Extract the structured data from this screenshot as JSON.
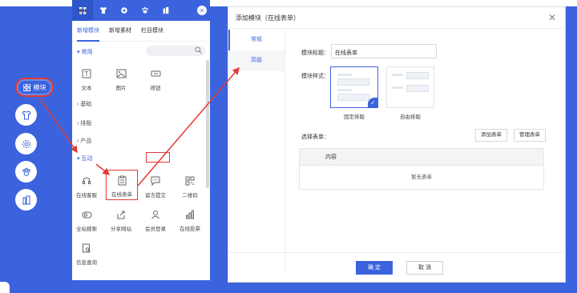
{
  "left_nav": {
    "module_label": "模块"
  },
  "panel": {
    "top_label": "模块",
    "tabs": [
      "新增模块",
      "新增素材",
      "栏目模块"
    ],
    "sections": {
      "common": "常用",
      "basic": "基础",
      "layout": "排版",
      "product": "产品",
      "interactive": "互动"
    },
    "common_modules": [
      "文本",
      "图片",
      "按钮"
    ],
    "interactive_modules": [
      "在线客服",
      "在线表单",
      "留言提交",
      "二维码",
      "全站搜索",
      "分享网站",
      "会员登录",
      "在线投票",
      "信息查询"
    ]
  },
  "dialog": {
    "title": "添加模块（在线表单）",
    "side_tabs": [
      "常规",
      "高级"
    ],
    "module_title_label": "模块标题：",
    "module_title_value": "在线表单",
    "module_style_label": "模块样式：",
    "style_fixed": "固定排版",
    "style_free": "自由排版",
    "choose_form_label": "选择表单：",
    "add_form": "添加表单",
    "manage_form": "管理表单",
    "table_header": "内容",
    "empty_text": "暂无表单",
    "confirm": "确 定",
    "cancel": "取 消"
  },
  "colors": {
    "accent": "#3b63dd",
    "highlight": "#e53935"
  }
}
